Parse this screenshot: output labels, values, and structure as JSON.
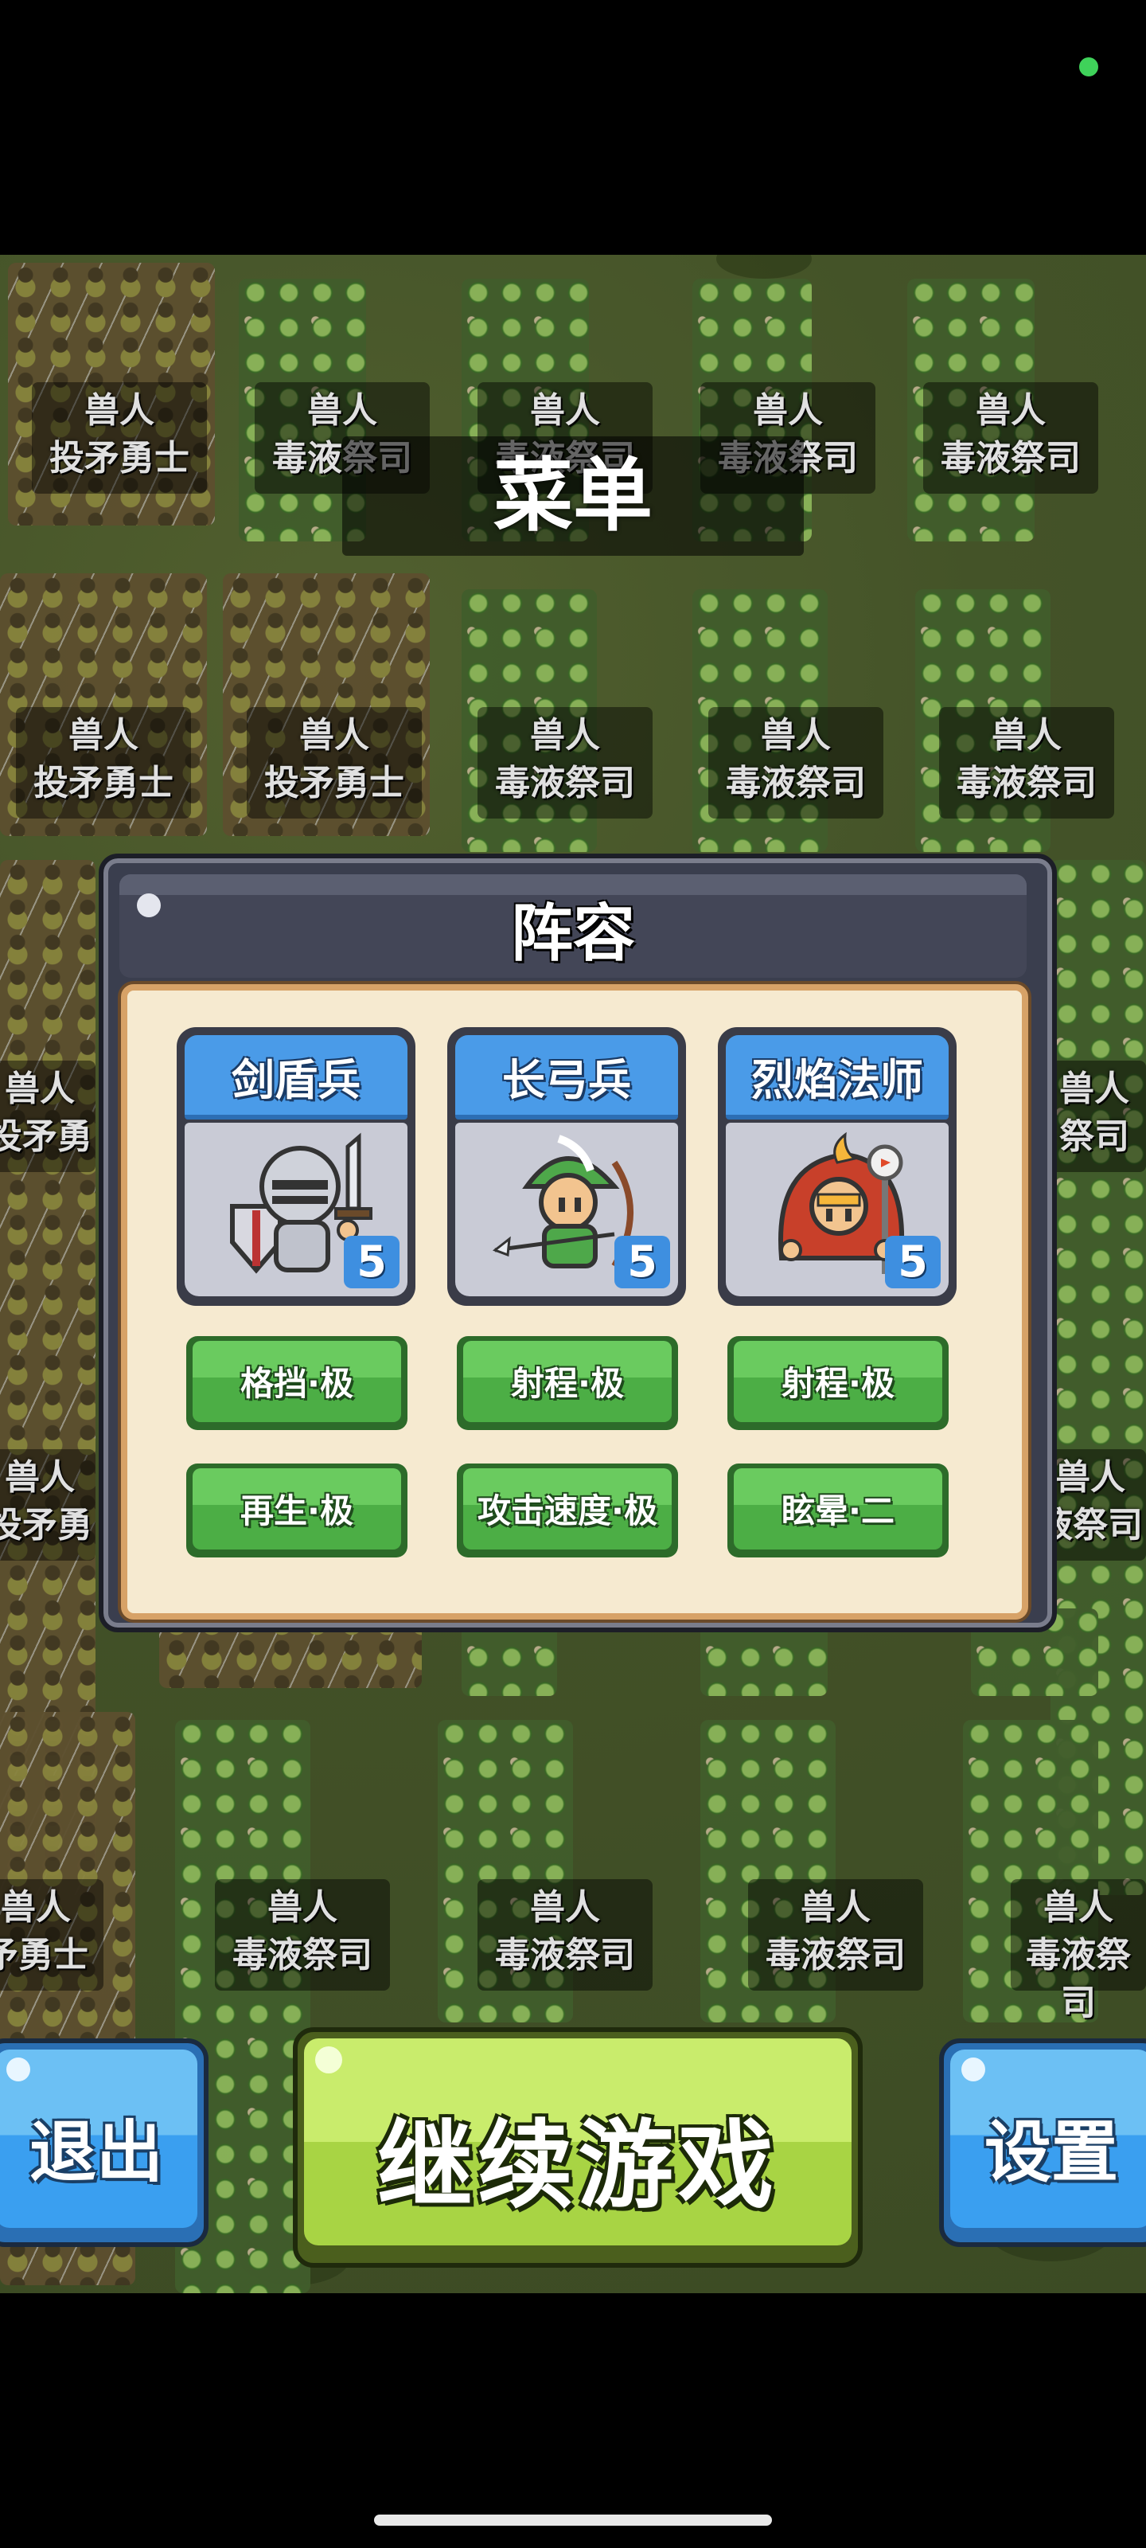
{
  "menu_title": "菜单",
  "field_labels": {
    "race": "兽人",
    "spearman": "投矛勇士",
    "shaman": "毒液祭司",
    "spearman_partial_left": "投矛勇",
    "shaman_partial_right": "液祭司",
    "shaman_partial_right_b": "祭司",
    "spearman_partial_b": "矛勇士"
  },
  "lineup": {
    "title": "阵容",
    "units": [
      {
        "name": "剑盾兵",
        "count": "5",
        "icon": "knight-icon"
      },
      {
        "name": "长弓兵",
        "count": "5",
        "icon": "archer-icon"
      },
      {
        "name": "烈焰法师",
        "count": "5",
        "icon": "fire-mage-icon"
      }
    ],
    "skills_row1": [
      "格挡·极",
      "射程·极",
      "射程·极"
    ],
    "skills_row2": [
      "再生·极",
      "攻击速度·极",
      "眩晕·二"
    ]
  },
  "buttons": {
    "quit": "退出",
    "continue": "继续游戏",
    "settings": "设置"
  },
  "colors": {
    "blue_button": "#3a9ff0",
    "green_button": "#a8d444",
    "skill_green": "#4cae45",
    "panel_cream": "#f6ead0"
  }
}
